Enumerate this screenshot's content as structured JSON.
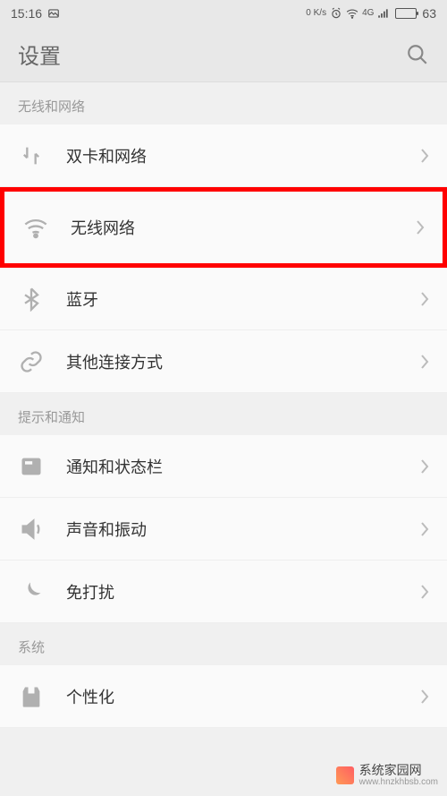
{
  "status_bar": {
    "time": "15:16",
    "net_speed_value": "0",
    "net_speed_unit": "K/s",
    "signal_label": "4G",
    "battery_percent": "63"
  },
  "header": {
    "title": "设置"
  },
  "sections": {
    "wireless": {
      "header": "无线和网络",
      "items": {
        "dual_sim": "双卡和网络",
        "wifi": "无线网络",
        "bluetooth": "蓝牙",
        "other_connections": "其他连接方式"
      }
    },
    "notifications": {
      "header": "提示和通知",
      "items": {
        "status_bar": "通知和状态栏",
        "sound": "声音和振动",
        "dnd": "免打扰"
      }
    },
    "system": {
      "header": "系统",
      "items": {
        "personalize": "个性化"
      }
    }
  },
  "watermark": {
    "main": "系统家园网",
    "sub": "www.hnzkhbsb.com"
  }
}
